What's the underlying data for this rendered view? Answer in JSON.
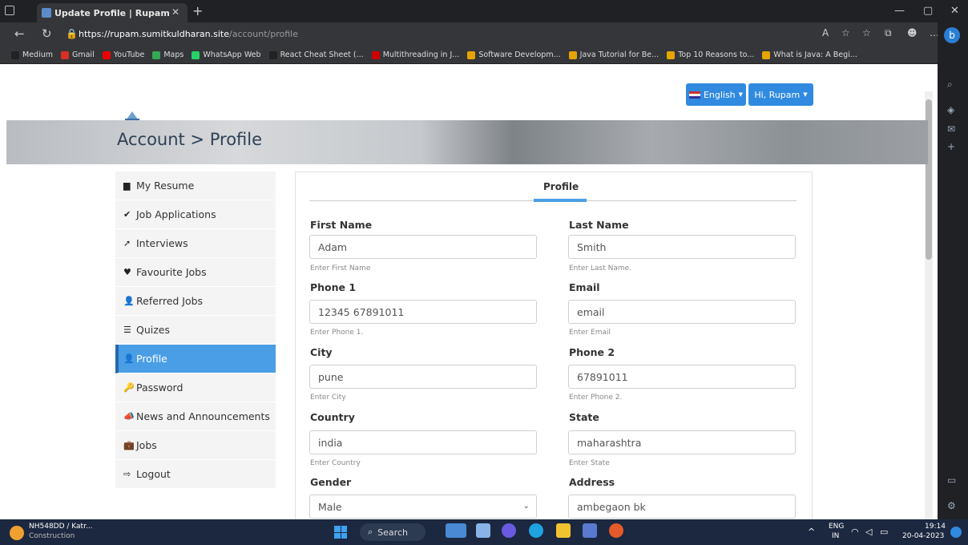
{
  "browser": {
    "tab_title": "Update Profile | Rupam",
    "url_host": "https://rupam.sumitkuldharan.site",
    "url_path": "/account/profile",
    "bookmarks": [
      {
        "label": "Medium",
        "color": "#222"
      },
      {
        "label": "Gmail",
        "color": "#d93025"
      },
      {
        "label": "YouTube",
        "color": "#e00"
      },
      {
        "label": "Maps",
        "color": "#34a853"
      },
      {
        "label": "WhatsApp Web",
        "color": "#25d366"
      },
      {
        "label": "React Cheat Sheet (...",
        "color": "#222"
      },
      {
        "label": "Multithreading in J...",
        "color": "#c00"
      },
      {
        "label": "Software Developm...",
        "color": "#e6a400"
      },
      {
        "label": "Java Tutorial for Be...",
        "color": "#e6a400"
      },
      {
        "label": "Top 10 Reasons to...",
        "color": "#e6a400"
      },
      {
        "label": "What is Java: A Begi...",
        "color": "#e6a400"
      }
    ]
  },
  "header": {
    "lang_label": "English",
    "user_label": "Hi, Rupam"
  },
  "hero": {
    "title": "Account > Profile"
  },
  "menu": {
    "items": [
      {
        "label": "My Resume",
        "icon": "file-icon",
        "glyph": "▆",
        "active": false
      },
      {
        "label": "Job Applications",
        "icon": "check-icon",
        "glyph": "✔",
        "active": false
      },
      {
        "label": "Interviews",
        "icon": "wrench-icon",
        "glyph": "➚",
        "active": false
      },
      {
        "label": "Favourite Jobs",
        "icon": "heart-icon",
        "glyph": "♥",
        "active": false
      },
      {
        "label": "Referred Jobs",
        "icon": "user-plus-icon",
        "glyph": "👤",
        "active": false
      },
      {
        "label": "Quizes",
        "icon": "list-icon",
        "glyph": "☰",
        "active": false
      },
      {
        "label": "Profile",
        "icon": "user-icon",
        "glyph": "👤",
        "active": true
      },
      {
        "label": "Password",
        "icon": "key-icon",
        "glyph": "🔑",
        "active": false
      },
      {
        "label": "News and Announcements",
        "icon": "bullhorn-icon",
        "glyph": "📣",
        "active": false
      },
      {
        "label": "Jobs",
        "icon": "briefcase-icon",
        "glyph": "💼",
        "active": false
      },
      {
        "label": "Logout",
        "icon": "logout-icon",
        "glyph": "⇨",
        "active": false
      }
    ]
  },
  "profile": {
    "tab_label": "Profile",
    "fields": {
      "first_name": {
        "label": "First Name",
        "value": "Adam",
        "hint": "Enter First Name"
      },
      "last_name": {
        "label": "Last Name",
        "value": "Smith",
        "hint": "Enter Last Name."
      },
      "phone1": {
        "label": "Phone 1",
        "value": "12345 67891011",
        "hint": "Enter Phone 1."
      },
      "email": {
        "label": "Email",
        "value": "email",
        "hint": "Enter Email"
      },
      "city": {
        "label": "City",
        "value": "pune",
        "hint": "Enter City"
      },
      "phone2": {
        "label": "Phone 2",
        "value": "67891011",
        "hint": "Enter Phone 2."
      },
      "country": {
        "label": "Country",
        "value": "india",
        "hint": "Enter Country"
      },
      "state": {
        "label": "State",
        "value": "maharashtra",
        "hint": "Enter State"
      },
      "gender": {
        "label": "Gender",
        "value": "Male"
      },
      "address": {
        "label": "Address",
        "value": "ambegaon bk"
      }
    }
  },
  "taskbar": {
    "weather_title": "NH548DD / Katr...",
    "weather_sub": "Construction",
    "search_label": "Search",
    "lang_top": "ENG",
    "lang_bottom": "IN",
    "time": "19:14",
    "date": "20-04-2023"
  }
}
